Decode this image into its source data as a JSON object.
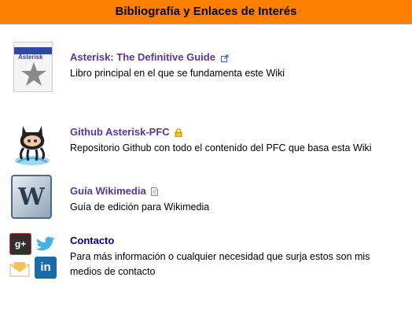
{
  "header": {
    "title": "Bibliografía y Enlaces de Interés"
  },
  "entries": [
    {
      "title": "Asterisk: The Definitive Guide",
      "description": "Libro principal en el que se fundamenta este Wiki",
      "thumb_text": "Asterisk",
      "link_icon": "external-link-icon"
    },
    {
      "title": "Github Asterisk-PFC",
      "description": "Repositorio Github con todo el contenido del PFC que basa esta Wiki",
      "link_icon": "lock-icon"
    },
    {
      "title": "Guía Wikimedia",
      "description": "Guía de edición para Wikimedia",
      "link_icon": "document-icon"
    },
    {
      "title": "Contacto",
      "description_line1": "Para más información o cualquier necesidad que surja estos son mis",
      "description_line2": "medios de contacto"
    }
  ],
  "colors": {
    "header_bg": "#ff7f00",
    "visited_link": "#5a3696",
    "link": "#0b0080"
  }
}
